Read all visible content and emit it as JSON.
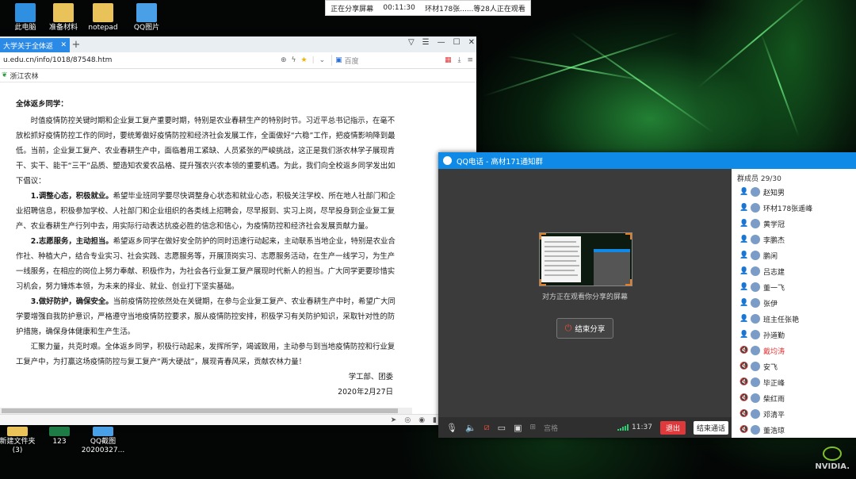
{
  "share_banner": {
    "status": "正在分享屏幕",
    "timer": "00:11:30",
    "watchers": "环材178张......等28人正在观看"
  },
  "desktop_icons_top": [
    {
      "label": "此电脑",
      "icon": "computer-icon",
      "color": "#2f8fe0"
    },
    {
      "label": "准备材料",
      "icon": "folder-icon",
      "color": "#e9c25a"
    },
    {
      "label": "notepad",
      "icon": "folder-icon",
      "color": "#e9c25a"
    },
    {
      "label": "QQ图片",
      "icon": "image-icon",
      "color": "#4aa0e6"
    }
  ],
  "desktop_icons_bottom": [
    {
      "label": "新建文件夹\n(3)",
      "line1": "新建文件夹",
      "line2": "(3)",
      "icon": "folder-icon",
      "color": "#e9c25a"
    },
    {
      "label": "123",
      "line1": "123",
      "line2": "",
      "icon": "excel-icon",
      "color": "#1e7b45"
    },
    {
      "label": "QQ截图\n20200327...",
      "line1": "QQ截图",
      "line2": "20200327...",
      "icon": "image-icon",
      "color": "#4aa0e6"
    }
  ],
  "browser": {
    "tab_title": "大学关于全体返",
    "url": "u.edu.cn/info/1018/87548.htm",
    "search_placeholder": "百度",
    "bookmark": "浙江农林"
  },
  "letter": {
    "greeting": "全体返乡同学：",
    "intro": "时值疫情防控关键时期和企业复工复产重要时期，特别是农业春耕生产的特别时节。习近平总书记指示，在毫不放松抓好疫情防控工作的同时，要统筹做好疫情防控和经济社会发展工作，全面做好“六稳”工作，把疫情影响降到最低。当前，企业复工复产、农业春耕生产中，面临着用工紧缺、人员紧张的严峻挑战，这正是我们浙农林学子展现肯干、实干、能干“三干”品质、塑造知农爱农品格、提升强农兴农本领的重要机遇。为此，我们向全校返乡同学发出如下倡议：",
    "p1_title": "1.调整心态，积极就业。",
    "p1_body": "希望毕业班同学要尽快调整身心状态和就业心态，积极关注学校、所在地人社部门和企业招聘信息，积极参加学校、人社部门和企业组织的各类线上招聘会，尽早报到、实习上岗，尽早投身到企业复工复产、农业春耕生产行列中去，用实际行动表达抗疫必胜的信念和信心，为疫情防控和经济社会发展贡献力量。",
    "p2_title": "2.志愿服务，主动担当。",
    "p2_body": "希望返乡同学在做好安全防护的同时迅速行动起来，主动联系当地企业，特别是农业合作社、种植大户，结合专业实习、社会实践、志愿服务等，开展顶岗实习、志愿服务活动，在生产一线学习，为生产一线服务，在相应的岗位上努力奉献、积极作为，为社会各行业复工复产展现时代新人的担当。广大同学更要珍惜实习机会，努力锤炼本领，为未来的择业、就业、创业打下坚实基础。",
    "p3_title": "3.做好防护，确保安全。",
    "p3_body": "当前疫情防控依然处在关键期，在参与企业复工复产、农业春耕生产中时，希望广大同学要增强自我防护意识，严格遵守当地疫情防控要求，服从疫情防控安排，积极学习有关防护知识，采取针对性的防护措施，确保身体健康和生产生活。",
    "closing": "汇聚力量，共克时艰。全体返乡同学，积极行动起来，发挥所学，竭诚致用，主动参与到当地疫情防控和行业复工复产中，为打赢这场疫情防控与复工复产“两大硬战”，展现青春风采，贡献农林力量！",
    "signature": "学工部、团委",
    "date": "2020年2月27日"
  },
  "qq": {
    "title": "QQ电话 - 高材171通知群",
    "preview_caption": "对方正在观看你分享的屏幕",
    "end_share": "结束分享",
    "grid_label": "宫格",
    "time": "11:37",
    "exit": "退出",
    "end_call": "结束通话",
    "member_count": "群成员 29/30",
    "members": [
      {
        "name": "赵知男",
        "speaking": false,
        "muted": false
      },
      {
        "name": "环材178张遥峰",
        "speaking": false,
        "muted": false
      },
      {
        "name": "黄学冠",
        "speaking": false,
        "muted": false
      },
      {
        "name": "李鹏杰",
        "speaking": false,
        "muted": false
      },
      {
        "name": "鹏闲",
        "speaking": false,
        "muted": false
      },
      {
        "name": "吕志建",
        "speaking": false,
        "muted": false
      },
      {
        "name": "董一飞",
        "speaking": false,
        "muted": false
      },
      {
        "name": "张伊",
        "speaking": false,
        "muted": false
      },
      {
        "name": "班主任张艳",
        "speaking": false,
        "muted": false
      },
      {
        "name": "孙道勤",
        "speaking": false,
        "muted": false
      },
      {
        "name": "戴均涛",
        "speaking": true,
        "muted": true
      },
      {
        "name": "安飞",
        "speaking": false,
        "muted": true
      },
      {
        "name": "毕正峰",
        "speaking": false,
        "muted": true
      },
      {
        "name": "柴红雨",
        "speaking": false,
        "muted": true
      },
      {
        "name": "邓清平",
        "speaking": false,
        "muted": true
      },
      {
        "name": "董浩琼",
        "speaking": false,
        "muted": true
      }
    ]
  },
  "nvidia_label": "NVIDIA."
}
